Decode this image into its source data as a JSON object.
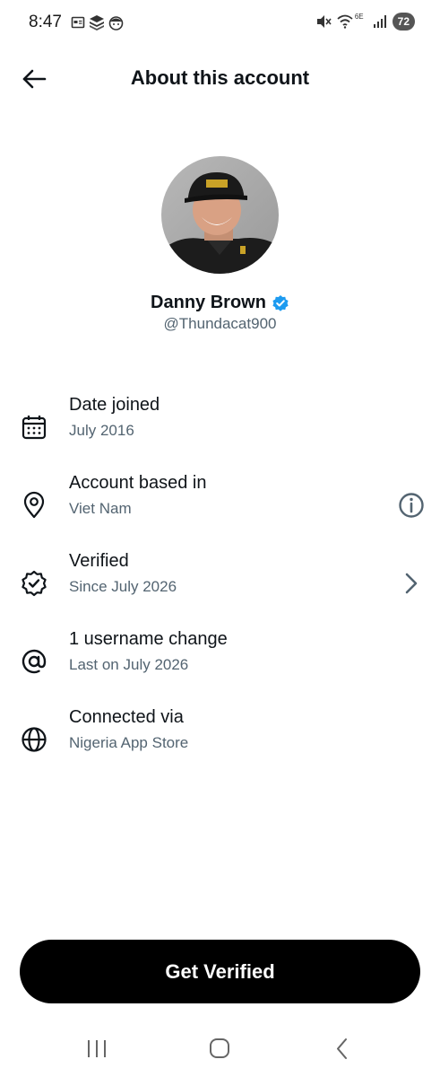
{
  "status_bar": {
    "time": "8:47",
    "battery": "72",
    "network_label": "6E",
    "icons": [
      "calendar-icon",
      "layers-icon",
      "face-icon",
      "mute-icon",
      "wifi-icon",
      "signal-icon",
      "battery-icon"
    ]
  },
  "header": {
    "title": "About this account",
    "back_icon": "arrow-left-icon"
  },
  "profile": {
    "display_name": "Danny Brown",
    "handle": "@Thundacat900",
    "verified_badge_color": "#1d9bf0"
  },
  "info_rows": [
    {
      "icon": "calendar-icon",
      "title": "Date joined",
      "subtitle": "July 2016"
    },
    {
      "icon": "location-pin-icon",
      "title": "Account based in",
      "subtitle": "Viet Nam",
      "action_icon": "info-icon"
    },
    {
      "icon": "verified-badge-icon",
      "title": "Verified",
      "subtitle": "Since July 2026",
      "action_icon": "chevron-right-icon"
    },
    {
      "icon": "at-sign-icon",
      "title": "1 username change",
      "subtitle": "Last on July 2026"
    },
    {
      "icon": "globe-icon",
      "title": "Connected via",
      "subtitle": "Nigeria App Store"
    }
  ],
  "cta": {
    "label": "Get Verified"
  },
  "colors": {
    "primary_text": "#0f1419",
    "secondary_text": "#536471",
    "verified_blue": "#1d9bf0",
    "button_bg": "#000000"
  }
}
